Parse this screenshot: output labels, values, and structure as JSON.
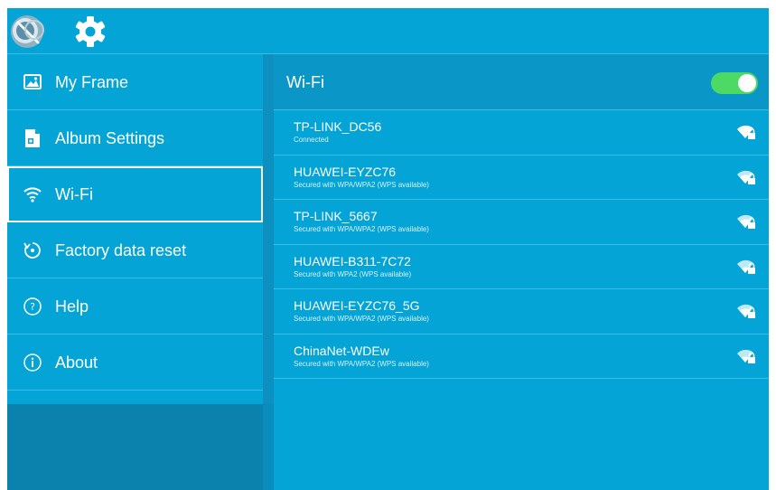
{
  "sidebar": {
    "items": [
      {
        "label": "My Frame",
        "icon": "photo-icon"
      },
      {
        "label": "Album Settings",
        "icon": "document-icon"
      },
      {
        "label": "Wi-Fi",
        "icon": "wifi-icon",
        "selected": true
      },
      {
        "label": "Factory data reset",
        "icon": "reset-icon"
      },
      {
        "label": "Help",
        "icon": "help-icon"
      },
      {
        "label": "About",
        "icon": "info-icon"
      }
    ]
  },
  "main": {
    "title": "Wi-Fi",
    "toggle_on": true,
    "networks": [
      {
        "ssid": "TP-LINK_DC56",
        "status": "Connected"
      },
      {
        "ssid": "HUAWEI-EYZC76",
        "status": "Secured with WPA/WPA2 (WPS available)"
      },
      {
        "ssid": "TP-LINK_5667",
        "status": "Secured with WPA/WPA2 (WPS available)"
      },
      {
        "ssid": "HUAWEI-B311-7C72",
        "status": "Secured with WPA2 (WPS available)"
      },
      {
        "ssid": "HUAWEI-EYZC76_5G",
        "status": "Secured with WPA/WPA2 (WPS available)"
      },
      {
        "ssid": "ChinaNet-WDEw",
        "status": "Secured with WPA/WPA2 (WPS available)"
      }
    ]
  },
  "colors": {
    "accent": "#04a4d6",
    "toggle": "#4cd964",
    "dark_panel": "#0b82ad"
  }
}
